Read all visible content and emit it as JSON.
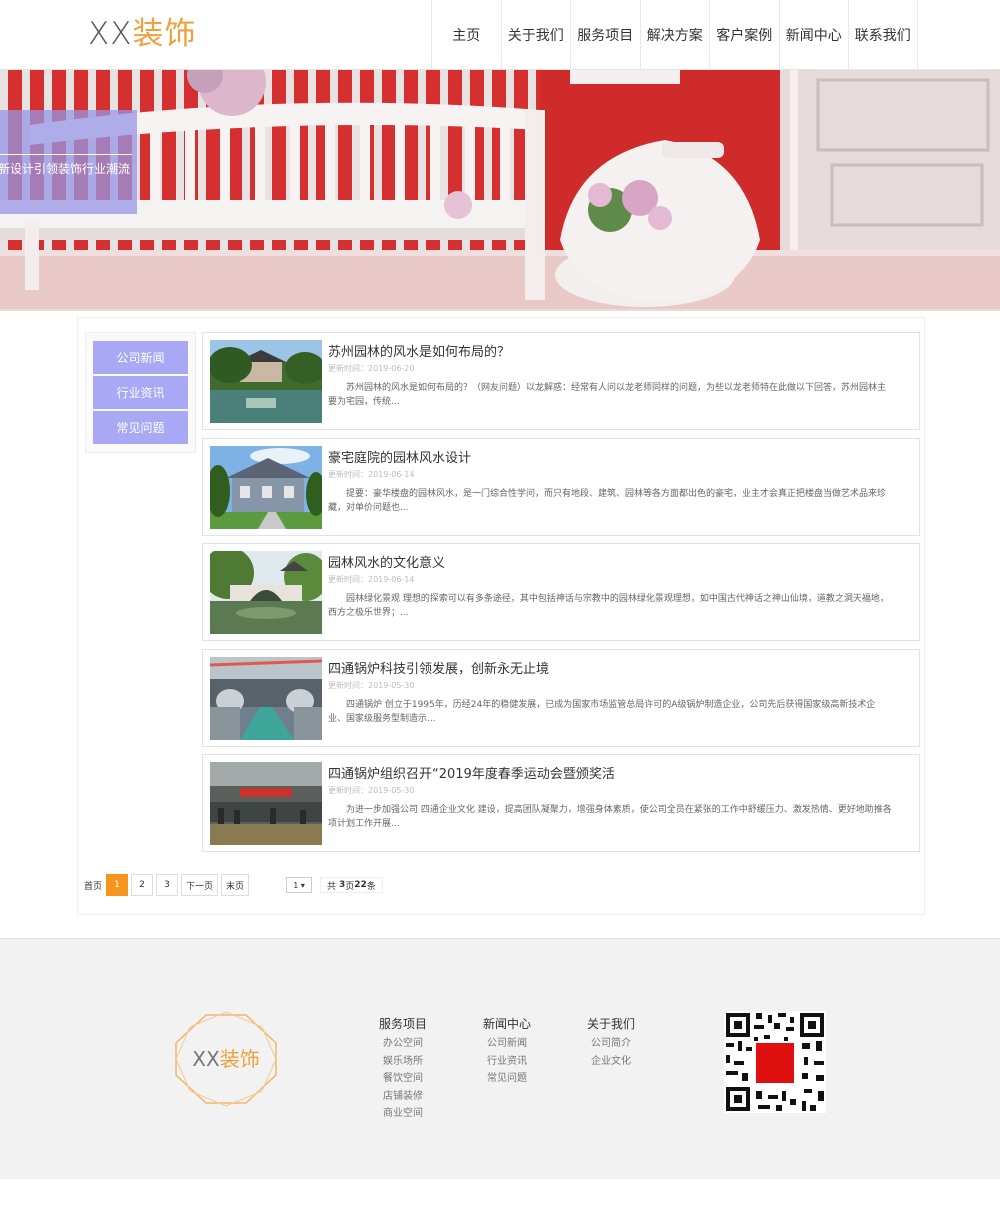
{
  "header": {
    "logo_xx": "XX",
    "logo_name": "装饰",
    "nav": [
      "主页",
      "关于我们",
      "服务项目",
      "解决方案",
      "客户案例",
      "新闻中心",
      "联系我们"
    ]
  },
  "banner": {
    "text": "新设计引领装饰行业潮流"
  },
  "sidebar": {
    "items": [
      "公司新闻",
      "行业资讯",
      "常见问题"
    ]
  },
  "articles": [
    {
      "title": "苏州园林的风水是如何布局的？",
      "date": "更新时间：2019-06-20",
      "desc": "苏州园林的风水是如何布局的？（网友问题）以龙解惑：经常有人问以龙老师同样的问题，为些以龙老师特在此做以下回答，苏州园林主要为宅园，传统..."
    },
    {
      "title": "豪宅庭院的园林风水设计",
      "date": "更新时间：2019-06-14",
      "desc": "提要：豪华楼盘的园林风水，是一门综合性学问，而只有地段、建筑、园林等各方面都出色的豪宅，业主才会真正把楼盘当做艺术品来珍藏，对单价问题也..."
    },
    {
      "title": "园林风水的文化意义",
      "date": "更新时间：2019-06-14",
      "desc": "园林绿化景观 理想的探索可以有多条途径，其中包括神话与宗教中的园林绿化景观理想，如中国古代神话之神山仙境，道教之洞天福地，西方之极乐世界；..."
    },
    {
      "title": "四通锅炉科技引领发展，创新永无止境",
      "date": "更新时间：2019-05-30",
      "desc": "四通锅炉 创立于1995年，历经24年的稳健发展，已成为国家市场监管总局许可的A级锅炉制造企业，公司先后获得国家级高新技术企业、国家级服务型制造示..."
    },
    {
      "title": "四通锅炉组织召开“2019年度春季运动会暨颁奖活",
      "date": "更新时间：2019-05-30",
      "desc": "为进一步加强公司 四通企业文化 建设，提高团队凝聚力，增强身体素质，使公司全员在紧张的工作中舒缓压力、激发热情、更好地助推各项计划工作开展..."
    }
  ],
  "pager": {
    "first": "首页",
    "pages": [
      "1",
      "2",
      "3"
    ],
    "active_page": "1",
    "next": "下一页",
    "last": "末页",
    "select_value": "1",
    "total_prefix": "共",
    "total_pages": "3",
    "total_mid": "页",
    "total_items": "22",
    "total_suffix": "条"
  },
  "footer": {
    "logo_xx": "XX",
    "logo_name": "装饰",
    "columns": [
      {
        "heading": "服务项目",
        "items": [
          "办公空间",
          "娱乐场所",
          "餐饮空间",
          "店铺装修",
          "商业空间"
        ]
      },
      {
        "heading": "新闻中心",
        "items": [
          "公司新闻",
          "行业资讯",
          "常见问题"
        ]
      },
      {
        "heading": "关于我们",
        "items": [
          "公司简介",
          "企业文化"
        ]
      }
    ]
  },
  "colors": {
    "accent": "#f7941d",
    "sidebar": "#a8a8f5",
    "logo_orange": "#f0a03c",
    "banner_red": "#d63533"
  }
}
